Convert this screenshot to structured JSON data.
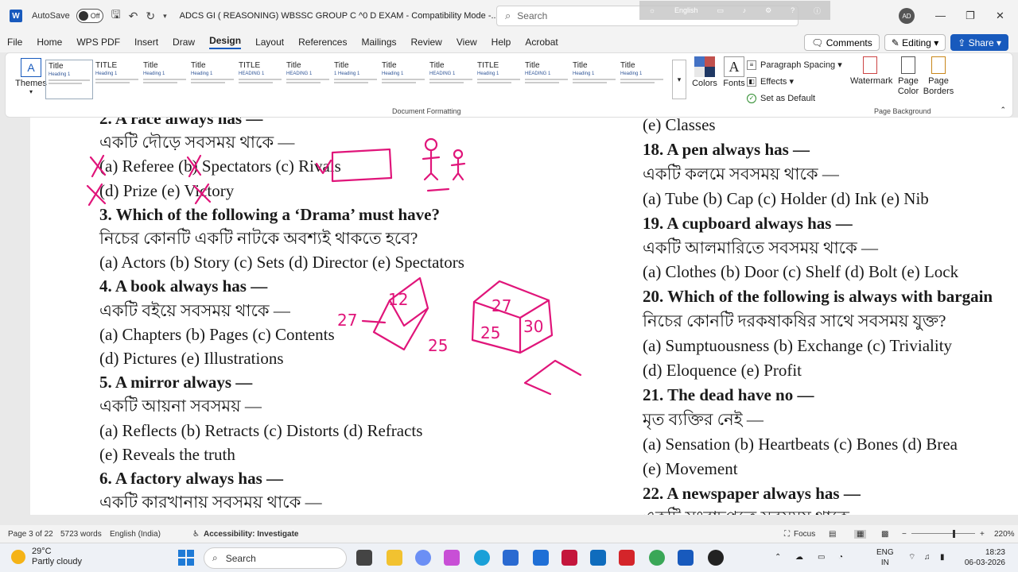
{
  "titlebar": {
    "autosave_label": "AutoSave",
    "autosave_state": "Off",
    "doc_title": "ADCS GI ( REASONING) WBSSC GROUP C ^0 D EXAM  -  Compatibility Mode  -...",
    "search_placeholder": "Search",
    "overlay_label": "English",
    "avatar_initials": "AD"
  },
  "menubar": {
    "items": [
      "File",
      "Home",
      "WPS PDF",
      "Insert",
      "Draw",
      "Design",
      "Layout",
      "References",
      "Mailings",
      "Review",
      "View",
      "Help",
      "Acrobat"
    ],
    "active": "Design",
    "comments_label": "Comments",
    "editing_label": "Editing",
    "share_label": "Share"
  },
  "ribbon": {
    "themes_label": "Themes",
    "style_thumbs": [
      {
        "title": "Title",
        "heading": "Heading 1"
      },
      {
        "title": "TITLE",
        "heading": "Heading 1"
      },
      {
        "title": "Title",
        "heading": "Heading 1"
      },
      {
        "title": "Title",
        "heading": "Heading 1"
      },
      {
        "title": "TITLE",
        "heading": "HEADING 1"
      },
      {
        "title": "Title",
        "heading": "HEADING 1"
      },
      {
        "title": "Title",
        "heading": "1 Heading 1"
      },
      {
        "title": "Title",
        "heading": "Heading 1"
      },
      {
        "title": "Title",
        "heading": "HEADING 1"
      },
      {
        "title": "TITLE",
        "heading": "Heading 1"
      },
      {
        "title": "Title",
        "heading": "HEADING 1"
      },
      {
        "title": "Title",
        "heading": "Heading 1"
      },
      {
        "title": "Title",
        "heading": "Heading 1"
      }
    ],
    "colors_label": "Colors",
    "fonts_label": "Fonts",
    "paragraph_spacing_label": "Paragraph Spacing",
    "effects_label": "Effects",
    "set_default_label": "Set as Default",
    "watermark_label": "Watermark",
    "page_color_label": "Page Color",
    "page_borders_label": "Page Borders",
    "group_document_formatting": "Document Formatting",
    "group_page_background": "Page Background"
  },
  "document": {
    "left_lines": [
      {
        "text": "2. A race always has —",
        "bold": true
      },
      {
        "text": "একটি দৌড়ে সবসময় থাকে —",
        "bold": false
      },
      {
        "text": "(a) Referee  (b) Spectators  (c) Rivals",
        "bold": false
      },
      {
        "text": "(d) Prize      (e) Victory",
        "bold": false
      },
      {
        "text": "3. Which of the following a ‘Drama’ must have?",
        "bold": true
      },
      {
        "text": "নিচের কোনটি একটি নাটকে অবশ্যই থাকতে হবে?",
        "bold": false
      },
      {
        "text": "(a) Actors  (b) Story  (c) Sets  (d) Director  (e) Spectators",
        "bold": false
      },
      {
        "text": "4. A book always has —",
        "bold": true
      },
      {
        "text": "একটি বইয়ে সবসময় থাকে —",
        "bold": false
      },
      {
        "text": "(a) Chapters  (b) Pages  (c) Contents",
        "bold": false
      },
      {
        "text": "(d) Pictures      (e) Illustrations",
        "bold": false
      },
      {
        "text": "5. A mirror always —",
        "bold": true
      },
      {
        "text": "একটি আয়না সবসময় —",
        "bold": false
      },
      {
        "text": "(a) Reflects  (b) Retracts  (c) Distorts  (d) Refracts",
        "bold": false
      },
      {
        "text": "(e) Reveals the truth",
        "bold": false
      },
      {
        "text": "6. A factory always has —",
        "bold": true
      },
      {
        "text": "একটি কারখানায় সবসময় থাকে —",
        "bold": false
      }
    ],
    "right_lines": [
      {
        "text": "(e) Classes",
        "bold": false
      },
      {
        "text": "18. A pen always has —",
        "bold": true
      },
      {
        "text": "একটি কলমে সবসময় থাকে —",
        "bold": false
      },
      {
        "text": "(a) Tube (b) Cap (c) Holder (d) Ink (e) Nib",
        "bold": false
      },
      {
        "text": "19. A cupboard always has —",
        "bold": true
      },
      {
        "text": "একটি আলমারিতে সবসময় থাকে —",
        "bold": false
      },
      {
        "text": "(a) Clothes (b) Door (c) Shelf (d) Bolt (e) Lock",
        "bold": false
      },
      {
        "text": "20. Which of the following is always with bargain",
        "bold": true
      },
      {
        "text": "নিচের কোনটি দরকষাকষির সাথে সবসময় যুক্ত?",
        "bold": false
      },
      {
        "text": "(a) Sumptuousness (b) Exchange  (c) Triviality",
        "bold": false
      },
      {
        "text": "(d) Eloquence   (e) Profit",
        "bold": false
      },
      {
        "text": "21. The dead have no —",
        "bold": true
      },
      {
        "text": "মৃত ব্যক্তির নেই —",
        "bold": false
      },
      {
        "text": "(a) Sensation  (b) Heartbeats  (c) Bones  (d) Brea",
        "bold": false
      },
      {
        "text": "(e) Movement",
        "bold": false
      },
      {
        "text": "22. A newspaper always has —",
        "bold": true
      },
      {
        "text": "একটি সংবাদপত্রে সবসময় থাকে",
        "bold": false
      }
    ],
    "annotations": {
      "cube1_numbers": [
        "12",
        "27",
        "25"
      ],
      "cube2_numbers": [
        "27",
        "25",
        "30"
      ],
      "ink_color": "#e0157a"
    }
  },
  "statusbar": {
    "page": "Page 3 of 22",
    "words": "5723 words",
    "language": "English (India)",
    "accessibility": "Accessibility: Investigate",
    "focus": "Focus",
    "zoom": "220%"
  },
  "taskbar": {
    "temperature": "29°C",
    "weather": "Partly cloudy",
    "search_label": "Search",
    "lang_top": "ENG",
    "lang_bottom": "IN",
    "time": "18:23",
    "date": "06-03-2026"
  },
  "colors": {
    "accent": "#185abd",
    "ink": "#e0157a"
  }
}
